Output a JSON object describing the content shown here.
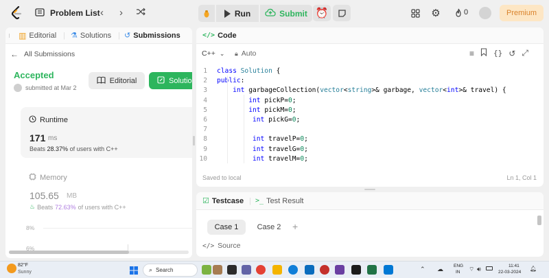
{
  "nav": {
    "problem_list": "Problem List",
    "run": "Run",
    "submit": "Submit",
    "streak_count": "0",
    "premium": "Premium"
  },
  "left": {
    "tabs": [
      "Editorial",
      "Solutions",
      "Submissions"
    ],
    "all_submissions": "All Submissions",
    "status": "Accepted",
    "submitted": "submitted at Mar 2",
    "editorial_btn": "Editorial",
    "solution_btn": "Solutio",
    "runtime": {
      "title": "Runtime",
      "value": "171",
      "unit": "ms",
      "beats_prefix": "Beats",
      "beats_pct": "28.37%",
      "beats_suffix": "of users with C++"
    },
    "memory": {
      "title": "Memory",
      "value": "105.65",
      "unit": "MB",
      "beats_prefix": "Beats",
      "beats_pct": "72.63%",
      "beats_suffix": "of users with C++"
    },
    "chart_ticks": [
      "8%",
      "6%"
    ]
  },
  "code": {
    "title": "Code",
    "language": "C++",
    "mode": "Auto",
    "saved": "Saved to local",
    "position": "Ln 1, Col 1",
    "lines": [
      {
        "n": "1",
        "indent": "",
        "parts": [
          [
            "kw",
            "class "
          ],
          [
            "ty",
            "Solution"
          ],
          [
            "txt",
            " {"
          ]
        ]
      },
      {
        "n": "2",
        "indent": "",
        "parts": [
          [
            "kw",
            "public"
          ],
          [
            "txt",
            ":"
          ]
        ]
      },
      {
        "n": "3",
        "indent": "    ",
        "parts": [
          [
            "kw",
            "int "
          ],
          [
            "txt",
            "garbageCollection("
          ],
          [
            "ty",
            "vector"
          ],
          [
            "txt",
            "<"
          ],
          [
            "ty",
            "string"
          ],
          [
            "txt",
            ">& garbage, "
          ],
          [
            "ty",
            "vector"
          ],
          [
            "txt",
            "<"
          ],
          [
            "kw",
            "int"
          ],
          [
            "txt",
            ">& travel) {"
          ]
        ]
      },
      {
        "n": "4",
        "indent": "        ",
        "parts": [
          [
            "kw",
            "int "
          ],
          [
            "txt",
            "pickP="
          ],
          [
            "num",
            "0"
          ],
          [
            "txt",
            ";"
          ]
        ]
      },
      {
        "n": "5",
        "indent": "        ",
        "parts": [
          [
            "kw",
            "int "
          ],
          [
            "txt",
            "pickM="
          ],
          [
            "num",
            "0"
          ],
          [
            "txt",
            ";"
          ]
        ]
      },
      {
        "n": "6",
        "indent": "         ",
        "parts": [
          [
            "kw",
            "int "
          ],
          [
            "txt",
            "pickG="
          ],
          [
            "num",
            "0"
          ],
          [
            "txt",
            ";"
          ]
        ]
      },
      {
        "n": "7",
        "indent": "",
        "parts": []
      },
      {
        "n": "8",
        "indent": "         ",
        "parts": [
          [
            "kw",
            "int "
          ],
          [
            "txt",
            "travelP="
          ],
          [
            "num",
            "0"
          ],
          [
            "txt",
            ";"
          ]
        ]
      },
      {
        "n": "9",
        "indent": "         ",
        "parts": [
          [
            "kw",
            "int "
          ],
          [
            "txt",
            "travelG="
          ],
          [
            "num",
            "0"
          ],
          [
            "txt",
            ";"
          ]
        ]
      },
      {
        "n": "10",
        "indent": "         ",
        "parts": [
          [
            "kw",
            "int "
          ],
          [
            "txt",
            "travelM="
          ],
          [
            "num",
            "0"
          ],
          [
            "txt",
            ";"
          ]
        ]
      }
    ]
  },
  "test": {
    "testcase_tab": "Testcase",
    "result_tab": "Test Result",
    "case1": "Case 1",
    "case2": "Case 2",
    "add": "+",
    "source": "Source"
  },
  "taskbar": {
    "weather_temp": "82°F",
    "weather_desc": "Sunny",
    "search": "Search",
    "lang1": "ENG",
    "lang2": "IN",
    "time": "11:41",
    "date": "22-03-2024"
  },
  "colors": {
    "accepted": "#2db55d",
    "solution_btn": "#2db55d",
    "premium_bg": "#fde6c4",
    "premium_text": "#d9822b"
  }
}
